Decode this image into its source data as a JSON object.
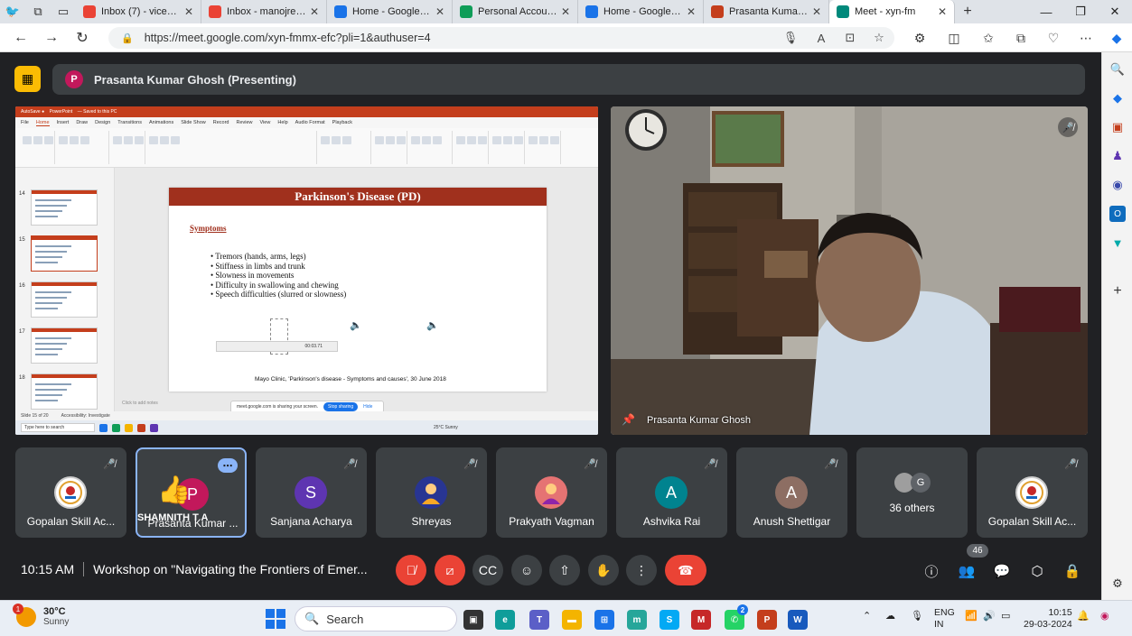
{
  "browser": {
    "tabs": [
      {
        "label": "Inbox (7) - viceprinc",
        "icon": "gmail-icon",
        "color": "#ea4335"
      },
      {
        "label": "Inbox - manojreddi",
        "icon": "gmail-icon",
        "color": "#ea4335"
      },
      {
        "label": "Home - Google Driv",
        "icon": "drive-icon",
        "color": "#1a73e8"
      },
      {
        "label": "Personal Accounts f",
        "icon": "sheets-icon",
        "color": "#0f9d58"
      },
      {
        "label": "Home - Google Driv",
        "icon": "drive-icon",
        "color": "#1a73e8"
      },
      {
        "label": "Prasanta Kumar Gh",
        "icon": "powerpoint-icon",
        "color": "#c43e1c"
      },
      {
        "label": "Meet - xyn-fm",
        "icon": "meet-icon",
        "color": "#00897b",
        "active": true
      }
    ],
    "url": "https://meet.google.com/xyn-fmmx-efc?pli=1&authuser=4"
  },
  "meet": {
    "presenter_initial": "P",
    "presenter_label": "Prasanta Kumar Ghosh (Presenting)",
    "camera_name": "Prasanta Kumar Ghosh",
    "time": "10:15 AM",
    "meeting_title": "Workshop on \"Navigating the Frontiers of Emer...",
    "participant_count": "46",
    "tiles": [
      {
        "name": "Gopalan Skill Ac...",
        "type": "logo"
      },
      {
        "name": "Prasanta Kumar ...",
        "initial": "P",
        "color": "#c2185b",
        "overlay": "SHAMNITH T A",
        "selected": true
      },
      {
        "name": "Sanjana Acharya",
        "initial": "S",
        "color": "#5e35b1"
      },
      {
        "name": "Shreyas",
        "type": "photo"
      },
      {
        "name": "Prakyath Vagman",
        "type": "photo"
      },
      {
        "name": "Ashvika Rai",
        "initial": "A",
        "color": "#00838f"
      },
      {
        "name": "Anush Shettigar",
        "initial": "A",
        "color": "#8d6e63"
      },
      {
        "name": "36 others",
        "initial": "G",
        "type": "others"
      },
      {
        "name": "Gopalan Skill Ac...",
        "type": "logo"
      }
    ]
  },
  "slide": {
    "title": "Parkinson's Disease (PD)",
    "section": "Symptoms",
    "bullets": [
      "Tremors (hands, arms, legs)",
      "Stiffness in limbs and trunk",
      "Slowness in movements",
      "Difficulty in swallowing and chewing",
      "Speech difficulties (slurred or slowness)"
    ],
    "citation": "Mayo Clinic, 'Parkinson's disease - Symptoms and causes', 30 June 2018",
    "thumb_numbers": [
      "14",
      "15",
      "16",
      "17",
      "18"
    ],
    "share_toast": "meet.google.com is sharing your screen.",
    "stop_sharing": "Stop sharing",
    "hide": "Hide",
    "ribbon_tabs": [
      "File",
      "Home",
      "Insert",
      "Draw",
      "Design",
      "Transitions",
      "Animations",
      "Slide Show",
      "Record",
      "Review",
      "View",
      "Help",
      "Audio Format",
      "Playback"
    ],
    "notes": "Click to add notes",
    "player_time": "00:03.71"
  },
  "taskbar": {
    "temp": "30°C",
    "condition": "Sunny",
    "weather_badge": "1",
    "search": "Search",
    "lang": "ENG",
    "region": "IN",
    "time": "10:15",
    "date": "29-03-2024",
    "whatsapp_badge": "2"
  }
}
